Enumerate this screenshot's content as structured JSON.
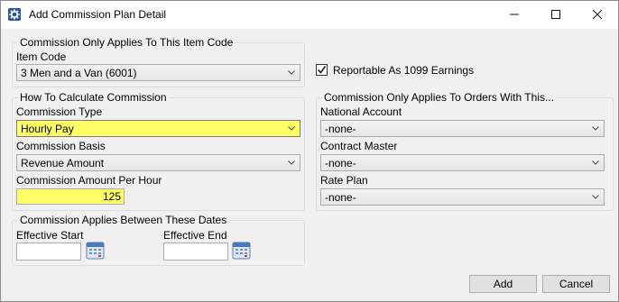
{
  "window": {
    "title": "Add Commission Plan Detail",
    "icon": "gear-icon"
  },
  "item_group": {
    "title": "Commission Only Applies To This Item Code",
    "item_code_label": "Item Code",
    "item_code_value": "3 Men and a Van (6001)"
  },
  "reportable": {
    "label": "Reportable As 1099 Earnings",
    "checked": true
  },
  "calc_group": {
    "title": "How To Calculate Commission",
    "type_label": "Commission Type",
    "type_value": "Hourly Pay",
    "basis_label": "Commission Basis",
    "basis_value": "Revenue Amount",
    "amount_label": "Commission Amount Per Hour",
    "amount_value": "125",
    "highlight_color": "#ffff66"
  },
  "orders_group": {
    "title": "Commission Only Applies To Orders With This...",
    "national_label": "National Account",
    "national_value": "-none-",
    "contract_label": "Contract Master",
    "contract_value": "-none-",
    "rate_label": "Rate Plan",
    "rate_value": "-none-"
  },
  "dates_group": {
    "title": "Commission Applies Between These Dates",
    "start_label": "Effective Start",
    "start_value": "",
    "end_label": "Effective End",
    "end_value": ""
  },
  "buttons": {
    "add": "Add",
    "cancel": "Cancel"
  }
}
